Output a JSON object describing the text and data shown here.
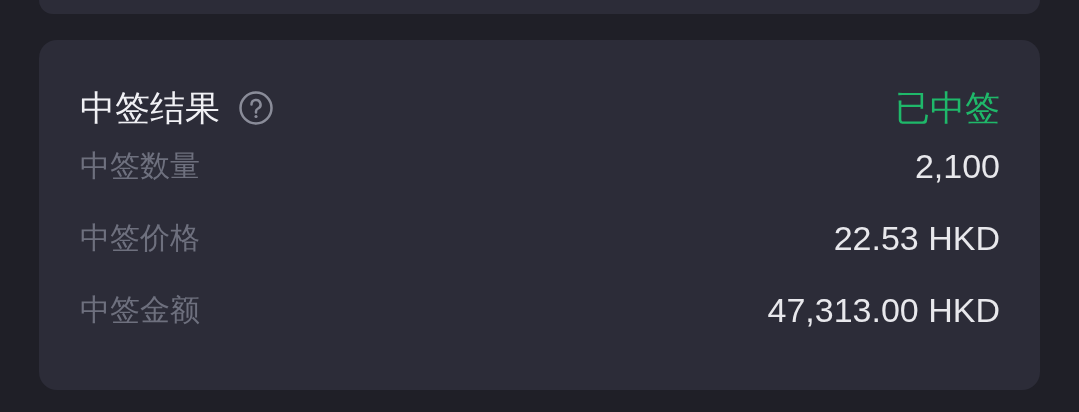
{
  "result_card": {
    "title": "中签结果",
    "status": {
      "label": "已中签",
      "kind": "won"
    },
    "rows": [
      {
        "label": "中签数量",
        "value": "2,100"
      },
      {
        "label": "中签价格",
        "value": "22.53 HKD"
      },
      {
        "label": "中签金额",
        "value": "47,313.00 HKD"
      }
    ]
  }
}
